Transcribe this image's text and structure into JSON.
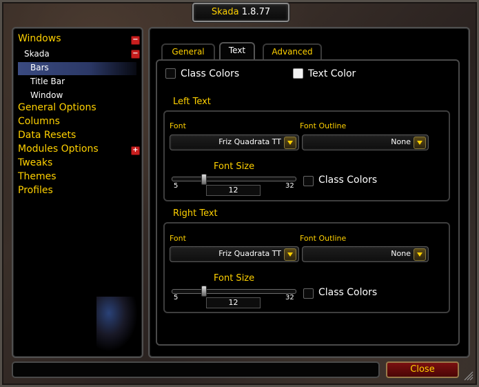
{
  "window": {
    "title_name": "Skada",
    "title_version": "1.8.77"
  },
  "tree": {
    "windows": "Windows",
    "skada": "Skada",
    "bars": "Bars",
    "title_bar": "Title Bar",
    "window": "Window",
    "general_options": "General Options",
    "columns": "Columns",
    "data_resets": "Data Resets",
    "modules_options": "Modules Options",
    "tweaks": "Tweaks",
    "themes": "Themes",
    "profiles": "Profiles",
    "collapse_symbol": "−",
    "expand_symbol": "+"
  },
  "tabs": [
    {
      "label": "General",
      "active": false
    },
    {
      "label": "Text",
      "active": true
    },
    {
      "label": "Advanced",
      "active": false
    }
  ],
  "top_options": {
    "class_colors_label": "Class Colors",
    "class_colors_checked": false,
    "text_color_label": "Text Color",
    "text_color_swatch": "#f2f2f2"
  },
  "left_text": {
    "heading": "Left Text",
    "font_label": "Font",
    "font_value": "Friz Quadrata TT",
    "outline_label": "Font Outline",
    "outline_value": "None",
    "size_label": "Font Size",
    "size_min": "5",
    "size_max": "32",
    "size_value": "12",
    "size_fraction": 0.259,
    "class_colors_label": "Class Colors",
    "class_colors_checked": false
  },
  "right_text": {
    "heading": "Right Text",
    "font_label": "Font",
    "font_value": "Friz Quadrata TT",
    "outline_label": "Font Outline",
    "outline_value": "None",
    "size_label": "Font Size",
    "size_min": "5",
    "size_max": "32",
    "size_value": "12",
    "size_fraction": 0.259,
    "class_colors_label": "Class Colors",
    "class_colors_checked": false
  },
  "footer": {
    "close_label": "Close",
    "status_text": ""
  },
  "colors": {
    "gold": "#ffd100",
    "highlight": "#3a4a80",
    "close_button": "#7a1010"
  }
}
